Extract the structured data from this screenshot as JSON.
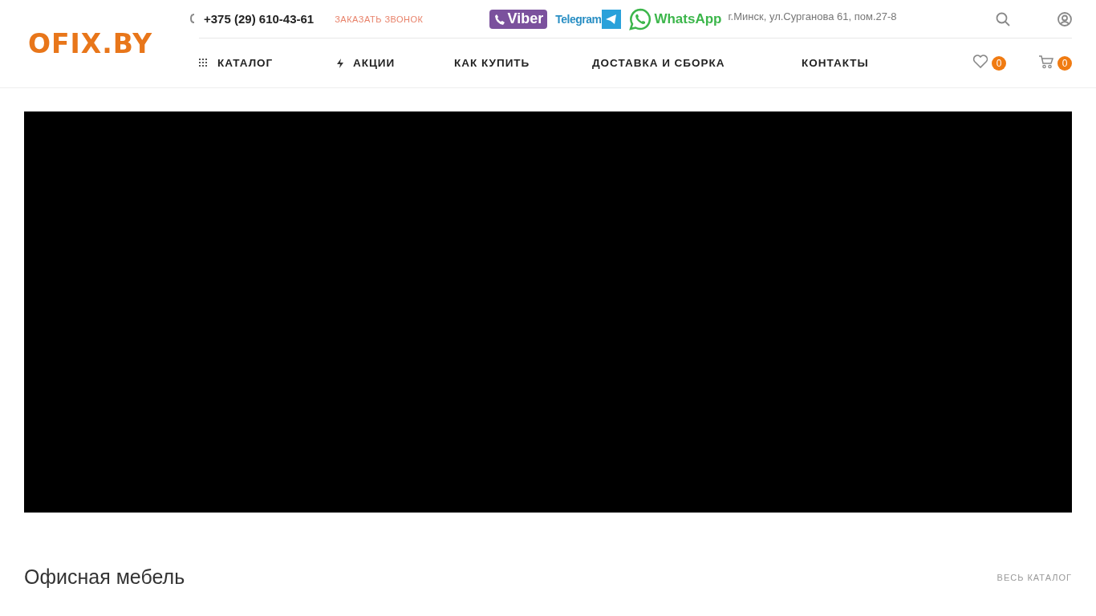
{
  "logo": "OFIX.BY",
  "contacts": {
    "phone": "+375 (29) 610-43-61",
    "callback": "ЗАКАЗАТЬ ЗВОНОК",
    "messengers": [
      {
        "kind": "viber",
        "label": "Viber"
      },
      {
        "kind": "telegram",
        "label": "Telegram"
      },
      {
        "kind": "whatsapp",
        "label": "WhatsApp"
      }
    ],
    "address": "г.Минск, ул.Сурганова 61, пом.27-8"
  },
  "nav": [
    {
      "kind": "catalog",
      "label": "КАТАЛОГ"
    },
    {
      "kind": "sale",
      "label": "АКЦИИ"
    },
    {
      "kind": "plain",
      "label": "КАК КУПИТЬ"
    },
    {
      "kind": "plain",
      "label": "ДОСТАВКА И СБОРКА"
    },
    {
      "kind": "plain",
      "label": "КОНТАКТЫ"
    }
  ],
  "counters": [
    {
      "kind": "favorites",
      "count": "0"
    },
    {
      "kind": "cart",
      "count": "0"
    }
  ],
  "section": {
    "title": "Офисная мебель",
    "link": "ВЕСЬ КАТАЛОГ"
  }
}
